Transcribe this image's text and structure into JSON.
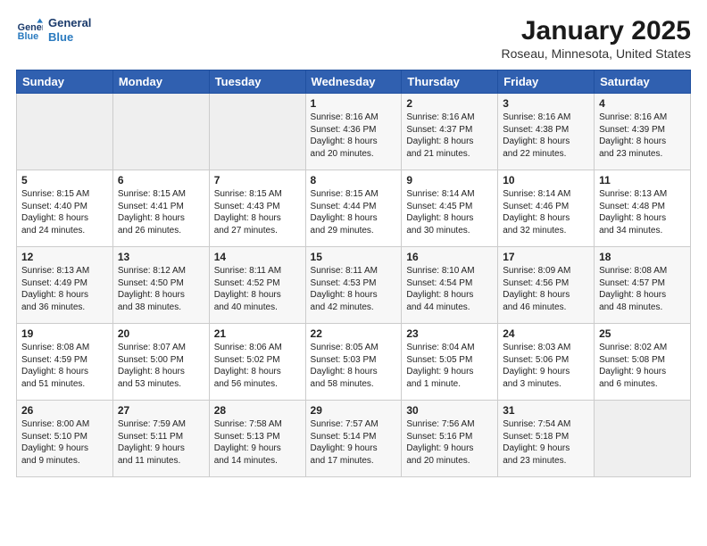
{
  "header": {
    "logo_line1": "General",
    "logo_line2": "Blue",
    "month": "January 2025",
    "location": "Roseau, Minnesota, United States"
  },
  "weekdays": [
    "Sunday",
    "Monday",
    "Tuesday",
    "Wednesday",
    "Thursday",
    "Friday",
    "Saturday"
  ],
  "weeks": [
    [
      {
        "day": "",
        "info": ""
      },
      {
        "day": "",
        "info": ""
      },
      {
        "day": "",
        "info": ""
      },
      {
        "day": "1",
        "info": "Sunrise: 8:16 AM\nSunset: 4:36 PM\nDaylight: 8 hours\nand 20 minutes."
      },
      {
        "day": "2",
        "info": "Sunrise: 8:16 AM\nSunset: 4:37 PM\nDaylight: 8 hours\nand 21 minutes."
      },
      {
        "day": "3",
        "info": "Sunrise: 8:16 AM\nSunset: 4:38 PM\nDaylight: 8 hours\nand 22 minutes."
      },
      {
        "day": "4",
        "info": "Sunrise: 8:16 AM\nSunset: 4:39 PM\nDaylight: 8 hours\nand 23 minutes."
      }
    ],
    [
      {
        "day": "5",
        "info": "Sunrise: 8:15 AM\nSunset: 4:40 PM\nDaylight: 8 hours\nand 24 minutes."
      },
      {
        "day": "6",
        "info": "Sunrise: 8:15 AM\nSunset: 4:41 PM\nDaylight: 8 hours\nand 26 minutes."
      },
      {
        "day": "7",
        "info": "Sunrise: 8:15 AM\nSunset: 4:43 PM\nDaylight: 8 hours\nand 27 minutes."
      },
      {
        "day": "8",
        "info": "Sunrise: 8:15 AM\nSunset: 4:44 PM\nDaylight: 8 hours\nand 29 minutes."
      },
      {
        "day": "9",
        "info": "Sunrise: 8:14 AM\nSunset: 4:45 PM\nDaylight: 8 hours\nand 30 minutes."
      },
      {
        "day": "10",
        "info": "Sunrise: 8:14 AM\nSunset: 4:46 PM\nDaylight: 8 hours\nand 32 minutes."
      },
      {
        "day": "11",
        "info": "Sunrise: 8:13 AM\nSunset: 4:48 PM\nDaylight: 8 hours\nand 34 minutes."
      }
    ],
    [
      {
        "day": "12",
        "info": "Sunrise: 8:13 AM\nSunset: 4:49 PM\nDaylight: 8 hours\nand 36 minutes."
      },
      {
        "day": "13",
        "info": "Sunrise: 8:12 AM\nSunset: 4:50 PM\nDaylight: 8 hours\nand 38 minutes."
      },
      {
        "day": "14",
        "info": "Sunrise: 8:11 AM\nSunset: 4:52 PM\nDaylight: 8 hours\nand 40 minutes."
      },
      {
        "day": "15",
        "info": "Sunrise: 8:11 AM\nSunset: 4:53 PM\nDaylight: 8 hours\nand 42 minutes."
      },
      {
        "day": "16",
        "info": "Sunrise: 8:10 AM\nSunset: 4:54 PM\nDaylight: 8 hours\nand 44 minutes."
      },
      {
        "day": "17",
        "info": "Sunrise: 8:09 AM\nSunset: 4:56 PM\nDaylight: 8 hours\nand 46 minutes."
      },
      {
        "day": "18",
        "info": "Sunrise: 8:08 AM\nSunset: 4:57 PM\nDaylight: 8 hours\nand 48 minutes."
      }
    ],
    [
      {
        "day": "19",
        "info": "Sunrise: 8:08 AM\nSunset: 4:59 PM\nDaylight: 8 hours\nand 51 minutes."
      },
      {
        "day": "20",
        "info": "Sunrise: 8:07 AM\nSunset: 5:00 PM\nDaylight: 8 hours\nand 53 minutes."
      },
      {
        "day": "21",
        "info": "Sunrise: 8:06 AM\nSunset: 5:02 PM\nDaylight: 8 hours\nand 56 minutes."
      },
      {
        "day": "22",
        "info": "Sunrise: 8:05 AM\nSunset: 5:03 PM\nDaylight: 8 hours\nand 58 minutes."
      },
      {
        "day": "23",
        "info": "Sunrise: 8:04 AM\nSunset: 5:05 PM\nDaylight: 9 hours\nand 1 minute."
      },
      {
        "day": "24",
        "info": "Sunrise: 8:03 AM\nSunset: 5:06 PM\nDaylight: 9 hours\nand 3 minutes."
      },
      {
        "day": "25",
        "info": "Sunrise: 8:02 AM\nSunset: 5:08 PM\nDaylight: 9 hours\nand 6 minutes."
      }
    ],
    [
      {
        "day": "26",
        "info": "Sunrise: 8:00 AM\nSunset: 5:10 PM\nDaylight: 9 hours\nand 9 minutes."
      },
      {
        "day": "27",
        "info": "Sunrise: 7:59 AM\nSunset: 5:11 PM\nDaylight: 9 hours\nand 11 minutes."
      },
      {
        "day": "28",
        "info": "Sunrise: 7:58 AM\nSunset: 5:13 PM\nDaylight: 9 hours\nand 14 minutes."
      },
      {
        "day": "29",
        "info": "Sunrise: 7:57 AM\nSunset: 5:14 PM\nDaylight: 9 hours\nand 17 minutes."
      },
      {
        "day": "30",
        "info": "Sunrise: 7:56 AM\nSunset: 5:16 PM\nDaylight: 9 hours\nand 20 minutes."
      },
      {
        "day": "31",
        "info": "Sunrise: 7:54 AM\nSunset: 5:18 PM\nDaylight: 9 hours\nand 23 minutes."
      },
      {
        "day": "",
        "info": ""
      }
    ]
  ]
}
